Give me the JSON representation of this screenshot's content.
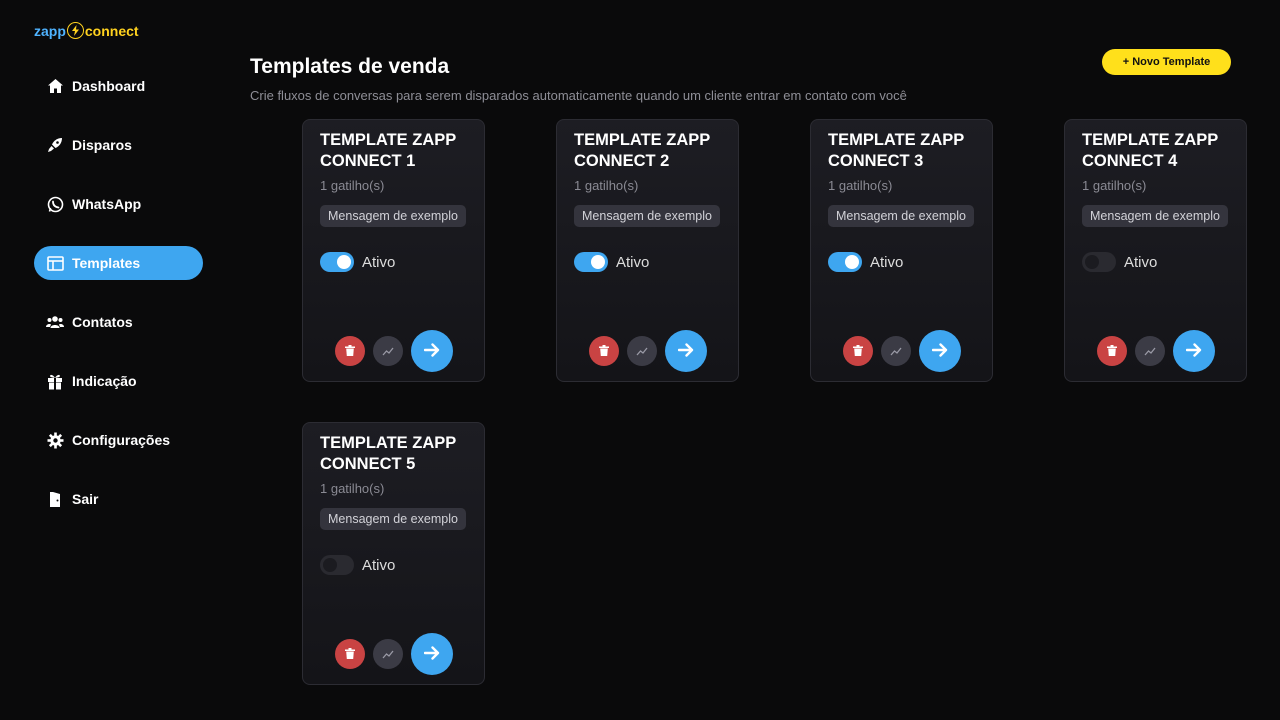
{
  "brand": {
    "part1": "zapp",
    "part2": "connect"
  },
  "nav": [
    {
      "label": "Dashboard",
      "icon": "home-icon"
    },
    {
      "label": "Disparos",
      "icon": "rocket-icon"
    },
    {
      "label": "WhatsApp",
      "icon": "whatsapp-icon"
    },
    {
      "label": "Templates",
      "icon": "template-icon",
      "active": true
    },
    {
      "label": "Contatos",
      "icon": "users-icon"
    },
    {
      "label": "Indicação",
      "icon": "gift-icon"
    },
    {
      "label": "Configurações",
      "icon": "gear-icon"
    },
    {
      "label": "Sair",
      "icon": "door-icon"
    }
  ],
  "header": {
    "title": "Templates de venda",
    "subtitle": "Crie fluxos de conversas para serem disparados automaticamente quando um cliente entrar em contato com você",
    "new_button": "+ Novo Template"
  },
  "templates": [
    {
      "title": "TEMPLATE ZAPP CONNECT 1",
      "triggers": "1 gatilho(s)",
      "message": "Mensagem de exemplo",
      "active": true,
      "status_label": "Ativo"
    },
    {
      "title": "TEMPLATE ZAPP CONNECT 2",
      "triggers": "1 gatilho(s)",
      "message": "Mensagem de exemplo",
      "active": true,
      "status_label": "Ativo"
    },
    {
      "title": "TEMPLATE ZAPP CONNECT 3",
      "triggers": "1 gatilho(s)",
      "message": "Mensagem de exemplo",
      "active": true,
      "status_label": "Ativo"
    },
    {
      "title": "TEMPLATE ZAPP CONNECT 4",
      "triggers": "1 gatilho(s)",
      "message": "Mensagem de exemplo",
      "active": false,
      "status_label": "Ativo"
    },
    {
      "title": "TEMPLATE ZAPP CONNECT 5",
      "triggers": "1 gatilho(s)",
      "message": "Mensagem de exemplo",
      "active": false,
      "status_label": "Ativo"
    }
  ],
  "colors": {
    "accent": "#3ea6f0",
    "brand_yellow": "#ffe01b",
    "danger": "#c94343",
    "background": "#0a0a0b"
  }
}
